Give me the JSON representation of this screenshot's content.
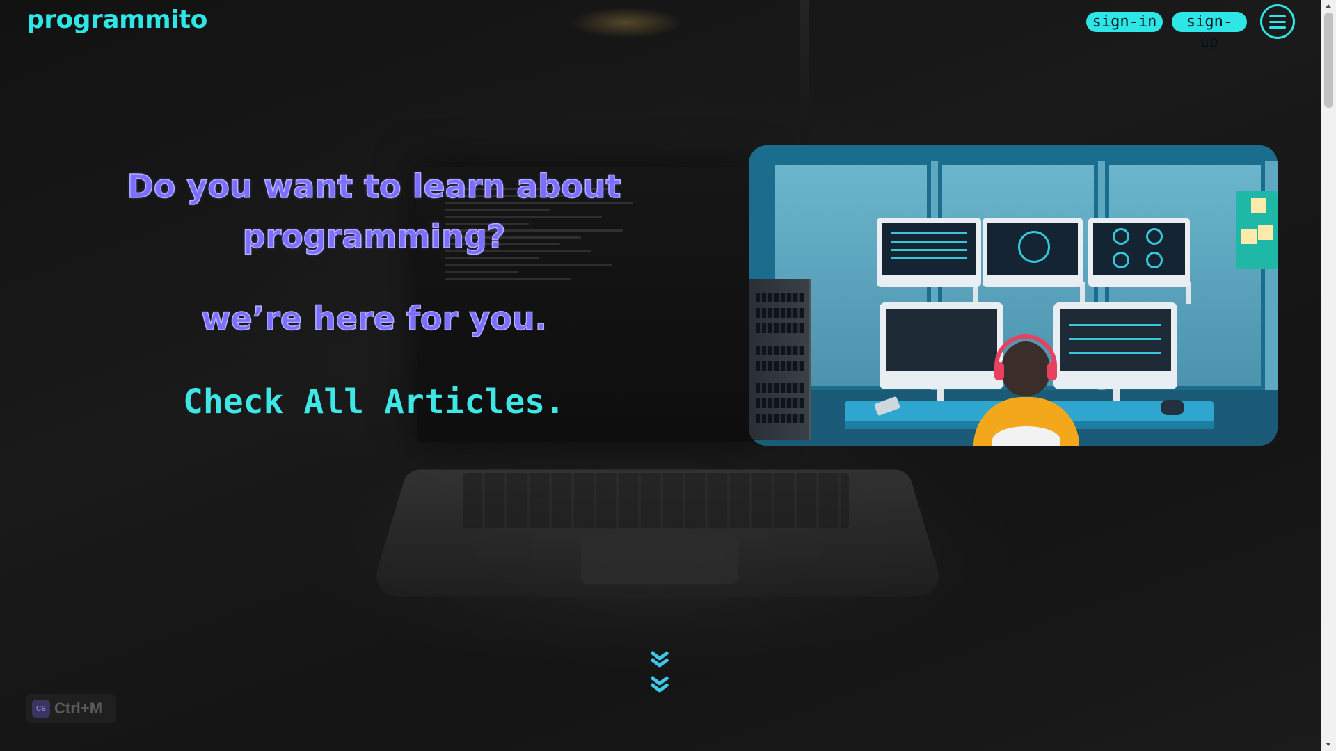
{
  "header": {
    "logo": "programmito",
    "sign_in": "sign-in",
    "sign_up": "sign-up",
    "menu_icon": "hamburger-menu-icon"
  },
  "hero": {
    "title": "Do you want to learn about programming?",
    "subtitle": "we’re here for you.",
    "link": "Check All Articles."
  },
  "illustration": {
    "icon": "programmer-at-desk-illustration"
  },
  "scroll_hint": {
    "icon": "double-chevron-down-icon"
  },
  "overlay": {
    "shortcut": "Ctrl+M",
    "shortcut_icon_text": "CS"
  },
  "colors": {
    "accent": "#2ee6e6",
    "title": "#7b6fff",
    "background": "#0d0d0d"
  }
}
